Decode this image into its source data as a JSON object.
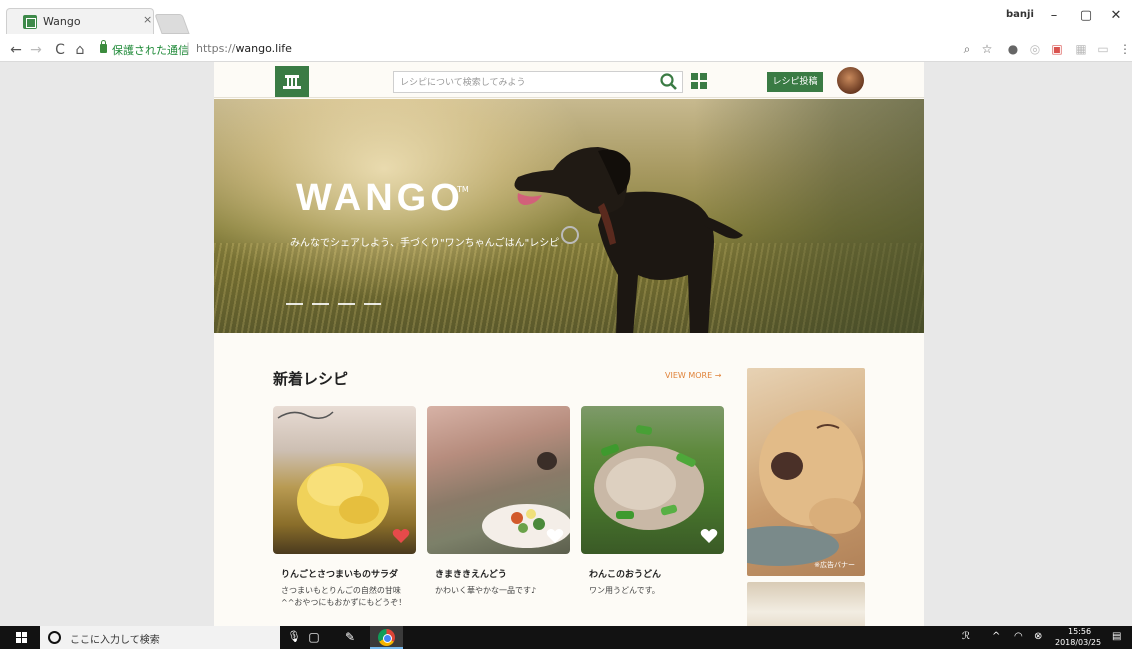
{
  "browser": {
    "tab_title": "Wango",
    "tab_close": "×",
    "user_label": "banji",
    "win_min": "–",
    "win_restore": "▢",
    "win_close": "✕",
    "nav_back": "←",
    "nav_forward": "→",
    "nav_reload": "C",
    "nav_home": "⌂",
    "secure_text": "保護された通信",
    "url_protocol": "https://",
    "url_host": "wango.life"
  },
  "header": {
    "search_placeholder": "レシピについて検索してみよう",
    "post_button": "レシピ投稿"
  },
  "hero": {
    "title": "WANGO",
    "trademark": "TM",
    "subtitle": "みんなでシェアしよう、手づくり\"ワンちゃんごはん\"レシピ",
    "slide_count": 4
  },
  "section": {
    "title": "新着レシピ",
    "view_more": "VIEW MORE →"
  },
  "recipes": [
    {
      "title": "りんごとさつまいものサラダ",
      "desc": "さつまいもとりんごの自然の甘味^^おやつにもおかずにもどうぞ！",
      "liked": true
    },
    {
      "title": "きまききえんどう",
      "desc": "かわいく華やかな一品です♪",
      "liked": false
    },
    {
      "title": "わんこのおうどん",
      "desc": "ワン用うどんです。",
      "liked": false
    }
  ],
  "ad": {
    "label": "※広告バナー"
  },
  "taskbar": {
    "search_text": "ここに入力して検索",
    "time": "15:56",
    "date": "2018/03/25"
  },
  "colors": {
    "brand_green": "#3a7b44",
    "accent_orange": "#e0833a",
    "heart_red": "#e64a4a"
  }
}
